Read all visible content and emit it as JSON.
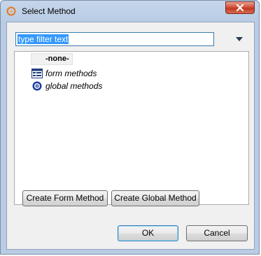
{
  "window": {
    "title": "Select Method"
  },
  "filter": {
    "value": "type filter text"
  },
  "tree": {
    "none_label": "-none-",
    "items": [
      {
        "label": "form methods",
        "icon": "form-icon"
      },
      {
        "label": "global methods",
        "icon": "global-icon"
      }
    ]
  },
  "buttons": {
    "create_form": "Create Form Method",
    "create_global": "Create Global Method",
    "ok": "OK",
    "cancel": "Cancel"
  }
}
